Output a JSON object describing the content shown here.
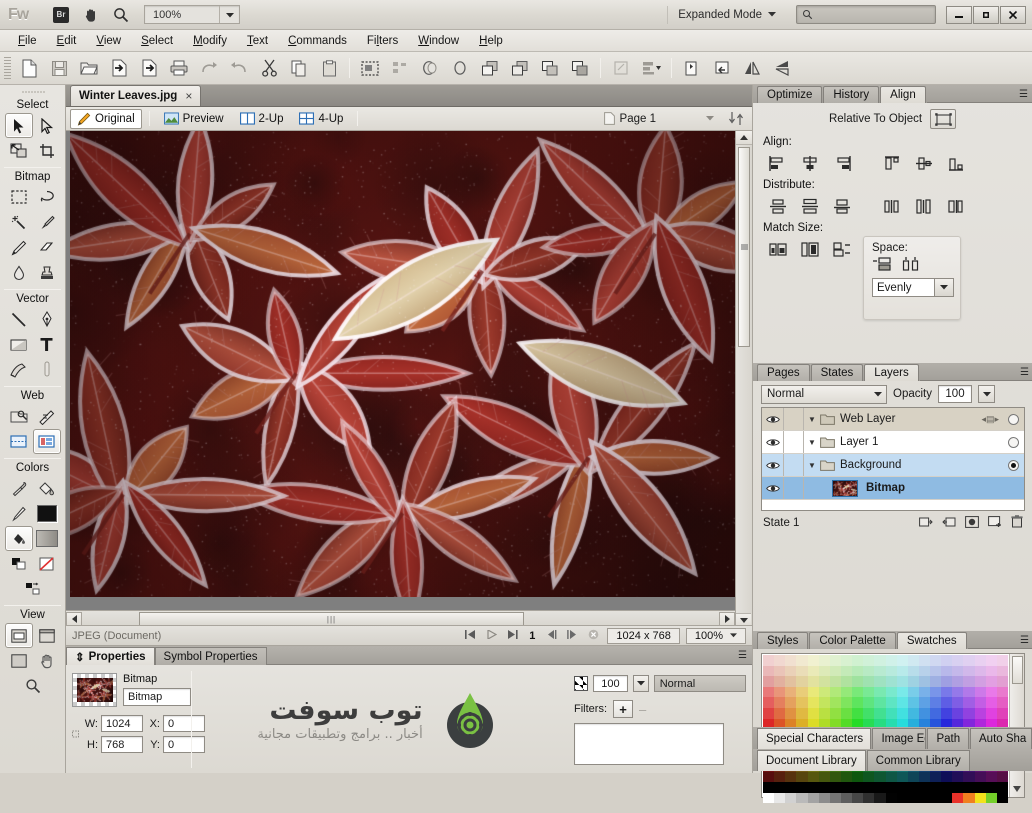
{
  "titlebar": {
    "app_logo": "Fw",
    "bridge_label": "Br",
    "hand_icon": "hand-icon",
    "zoom_icon": "magnifier-icon",
    "zoom_value": "100%",
    "mode_label": "Expanded Mode",
    "search_placeholder": "",
    "minimize": "—",
    "maximize": "□",
    "close": "×"
  },
  "menubar": {
    "items": [
      {
        "label": "File",
        "accel": "F"
      },
      {
        "label": "Edit",
        "accel": "E"
      },
      {
        "label": "View",
        "accel": "V"
      },
      {
        "label": "Select",
        "accel": "S"
      },
      {
        "label": "Modify",
        "accel": "M"
      },
      {
        "label": "Text",
        "accel": "T"
      },
      {
        "label": "Commands",
        "accel": "C"
      },
      {
        "label": "Filters",
        "accel": "l"
      },
      {
        "label": "Window",
        "accel": "W"
      },
      {
        "label": "Help",
        "accel": "H"
      }
    ]
  },
  "toolbar": {
    "buttons": [
      "new-icon",
      "save-icon",
      "open-icon",
      "import-icon",
      "export-icon",
      "print-icon",
      "undo-icon",
      "redo-icon",
      "cut-icon",
      "copy-icon",
      "paste-icon",
      "marquee-icon",
      "distribute-icon",
      "union-icon",
      "intersect-icon",
      "arrange-front-icon",
      "arrange-forward-icon",
      "arrange-backward-icon",
      "arrange-back-icon",
      "group-icon",
      "align-icon",
      "rotate-90cw-icon",
      "rotate-90ccw-icon",
      "flip-horizontal-icon",
      "flip-vertical-icon"
    ]
  },
  "tools": {
    "sections": [
      {
        "title": "Select",
        "tools": [
          "pointer-tool",
          "subselection-tool",
          "scale-tool",
          "crop-tool"
        ],
        "selected": "pointer-tool"
      },
      {
        "title": "Bitmap",
        "tools": [
          "marquee-tool",
          "lasso-tool",
          "magic-wand-tool",
          "brush-tool",
          "pencil-tool",
          "eraser-tool",
          "blur-tool",
          "rubber-stamp-tool"
        ],
        "selected": ""
      },
      {
        "title": "Vector",
        "tools": [
          "line-tool",
          "pen-tool",
          "rectangle-tool",
          "text-tool",
          "freeform-tool",
          "knife-tool"
        ],
        "selected": ""
      },
      {
        "title": "Web",
        "tools": [
          "hotspot-tool",
          "polygon-hotspot-tool",
          "slice-tool",
          "polygon-slice-tool"
        ],
        "selected": "polygon-slice-tool"
      },
      {
        "title": "Colors",
        "tools": [
          "eyedropper-tool",
          "paint-bucket-tool",
          "stroke-color",
          "fill-color",
          "paint-bucket-swatch",
          "gradient-swatch",
          "default-colors",
          "no-color",
          "swap-colors"
        ],
        "selected": "paint-bucket-swatch"
      },
      {
        "title": "View",
        "tools": [
          "standard-screen-mode",
          "full-screen-menu-mode",
          "full-screen-mode",
          "hand-tool",
          "zoom-tool"
        ],
        "selected": "standard-screen-mode"
      }
    ]
  },
  "document": {
    "tab_title": "Winter Leaves.jpg",
    "tab_close": "×",
    "views": [
      {
        "label": "Original",
        "icon": "pencil-icon",
        "selected": true
      },
      {
        "label": "Preview",
        "icon": "image-icon",
        "selected": false
      },
      {
        "label": "2-Up",
        "icon": "two-up-icon",
        "selected": false
      },
      {
        "label": "4-Up",
        "icon": "four-up-icon",
        "selected": false
      }
    ],
    "page_label": "Page 1",
    "page_icon": "page-icon",
    "sort_icon": "sort-arrows-icon"
  },
  "statusbar": {
    "format": "JPEG (Document)",
    "frame_number": "1",
    "dimensions": "1024 x 768",
    "zoom": "100%",
    "nav_icons": [
      "first-frame-icon",
      "play-icon",
      "last-frame-icon",
      "prev-frame-icon",
      "next-frame-icon",
      "stop-icon"
    ]
  },
  "properties": {
    "tabs": [
      {
        "label": "Properties",
        "selected": true
      },
      {
        "label": "Symbol Properties",
        "selected": false
      }
    ],
    "object_type": "Bitmap",
    "object_name": "Bitmap",
    "w_label": "W:",
    "w_value": "1024",
    "h_label": "H:",
    "h_value": "768",
    "x_label": "X:",
    "x_value": "0",
    "y_label": "Y:",
    "y_value": "0",
    "opacity_value": "100",
    "blend_mode": "Normal",
    "filters_label": "Filters:",
    "filters_add": "+",
    "filters_remove": "–"
  },
  "watermark": {
    "title": "توب سوفت",
    "subtitle": "أخبار .. برامج وتطبيقات مجانية",
    "logo_icon": "droplet-gear-logo",
    "logo_green": "#7ac143",
    "logo_dark": "#3b3f40"
  },
  "align_panel": {
    "tabs": [
      {
        "label": "Optimize",
        "selected": false
      },
      {
        "label": "History",
        "selected": false
      },
      {
        "label": "Align",
        "selected": true
      }
    ],
    "relative_label": "Relative To Object",
    "relative_icon": "relative-object-icon",
    "align_label": "Align:",
    "align_buttons": [
      "align-left-icon",
      "align-center-horizontal-icon",
      "align-right-icon",
      "align-top-icon",
      "align-middle-vertical-icon",
      "align-bottom-icon"
    ],
    "distribute_label": "Distribute:",
    "distribute_buttons": [
      "distribute-top-icon",
      "distribute-middle-icon",
      "distribute-bottom-icon",
      "distribute-left-icon",
      "distribute-center-icon",
      "distribute-right-icon"
    ],
    "match_label": "Match Size:",
    "match_buttons": [
      "match-width-icon",
      "match-height-icon",
      "match-both-icon"
    ],
    "space_label": "Space:",
    "space_buttons": [
      "space-horizontal-icon",
      "space-vertical-icon"
    ],
    "space_value": "Evenly"
  },
  "layers_panel": {
    "tabs": [
      {
        "label": "Pages",
        "selected": false
      },
      {
        "label": "States",
        "selected": false
      },
      {
        "label": "Layers",
        "selected": true
      }
    ],
    "blend_mode": "Normal",
    "opacity_label": "Opacity",
    "opacity_value": "100",
    "rows": [
      {
        "name": "Web Layer",
        "type": "weblayer",
        "expanded": true,
        "visible": true,
        "selected": false,
        "active": false
      },
      {
        "name": "Layer 1",
        "type": "layer",
        "expanded": true,
        "visible": true,
        "selected": false,
        "active": false
      },
      {
        "name": "Background",
        "type": "layer",
        "expanded": true,
        "visible": true,
        "selected": true,
        "active": true
      },
      {
        "name": "Bitmap",
        "type": "object",
        "expanded": false,
        "visible": true,
        "selected": true,
        "active": false
      }
    ],
    "state_label": "State 1",
    "footer_icons": [
      "new-state-icon",
      "duplicate-state-icon",
      "add-mask-icon",
      "new-layer-icon",
      "delete-icon"
    ]
  },
  "swatches_panel": {
    "tabs": [
      {
        "label": "Styles",
        "selected": false
      },
      {
        "label": "Color Palette",
        "selected": false
      },
      {
        "label": "Swatches",
        "selected": true
      }
    ]
  },
  "bottom_tabs": {
    "row1": [
      {
        "label": "Special Characters",
        "selected": true
      },
      {
        "label": "Image Ed",
        "selected": false
      },
      {
        "label": "Path",
        "selected": false
      },
      {
        "label": "Auto Sha",
        "selected": false
      }
    ],
    "row2": [
      {
        "label": "Document Library",
        "selected": true
      },
      {
        "label": "Common Library",
        "selected": false
      }
    ]
  },
  "colors": {
    "accent_selection": "#8fbbe2",
    "weblayer_row": "#d8d2c4",
    "panel_bg": "#dcd9d2",
    "chrome_dark": "#8a8a8a"
  }
}
